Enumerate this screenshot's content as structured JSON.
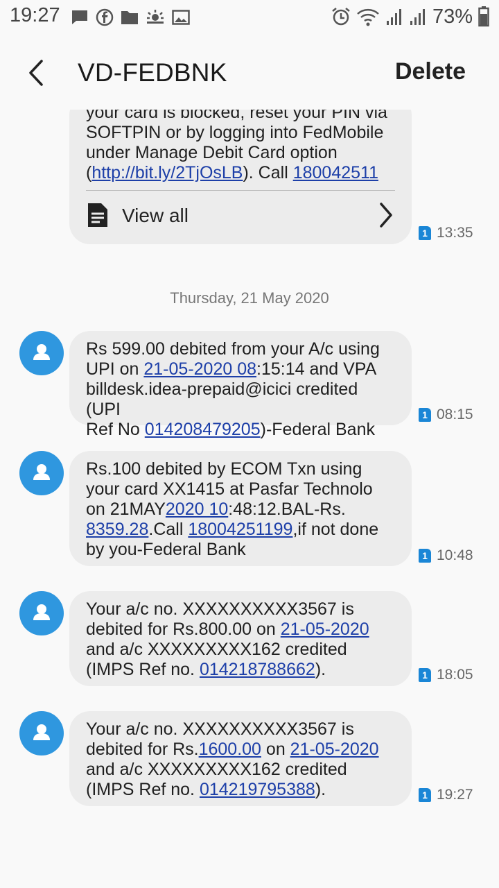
{
  "status_bar": {
    "time": "19:27",
    "battery": "73%",
    "left_icons": [
      "message-icon",
      "facebook-icon",
      "folder-icon",
      "weather-icon",
      "image-icon"
    ],
    "right_icons": [
      "alarm-icon",
      "wifi-icon",
      "signal-icon",
      "signal-icon",
      "battery-icon"
    ]
  },
  "header": {
    "title": "VD-FEDBNK",
    "delete_label": "Delete"
  },
  "first_message": {
    "line1": "your card is blocked, reset your PIN via",
    "line2": "SOFTPIN or by logging into FedMobile",
    "line3": "under Manage Debit Card option",
    "line4_pre": "(",
    "line4_link": "http://bit.ly/2TjOsLB",
    "line4_mid": "). Call ",
    "line4_phone": "180042511",
    "view_all": "View all",
    "sim": "1",
    "time": "13:35"
  },
  "date_separator": "Thursday, 21 May 2020",
  "messages": [
    {
      "l1": "Rs 599.00 debited from your A/c using",
      "l2_pre": "UPI on ",
      "l2_link": "21-05-2020 08",
      "l2_post": ":15:14 and VPA",
      "l3": "billdesk.idea-prepaid@icici credited (UPI",
      "l4_pre": "Ref No ",
      "l4_link": "014208479205",
      "l4_post": ")-Federal Bank",
      "sim": "1",
      "time": "08:15"
    },
    {
      "l1": "Rs.100 debited by ECOM Txn using",
      "l2": "your card XX1415 at Pasfar Technolo",
      "l3_pre": "on 21MAY",
      "l3_link": "2020 10",
      "l3_post": ":48:12.BAL-Rs.",
      "l4_link1": "8359.28",
      "l4_mid": ".Call ",
      "l4_link2": "18004251199",
      "l4_post": ",if not done",
      "l5": "by you-Federal Bank",
      "sim": "1",
      "time": "10:48"
    },
    {
      "l1": "Your a/c no. XXXXXXXXXX3567 is",
      "l2_pre": "debited for Rs.800.00 on ",
      "l2_link": "21-05-2020",
      "l3": "and a/c XXXXXXXXX162 credited",
      "l4_pre": "(IMPS Ref no. ",
      "l4_link": "014218788662",
      "l4_post": ").",
      "sim": "1",
      "time": "18:05"
    },
    {
      "l1": "Your a/c no. XXXXXXXXXX3567 is",
      "l2_pre": "debited for Rs.",
      "l2_link1": "1600.00",
      "l2_mid": " on ",
      "l2_link2": "21-05-2020",
      "l3": "and a/c XXXXXXXXX162 credited",
      "l4_pre": "(IMPS Ref no. ",
      "l4_link": "014219795388",
      "l4_post": ").",
      "sim": "1",
      "time": "19:27"
    }
  ],
  "colors": {
    "bubble": "#ececec",
    "link": "#1d3fa8",
    "avatar": "#2f97df",
    "sim_badge": "#1a86d6"
  }
}
